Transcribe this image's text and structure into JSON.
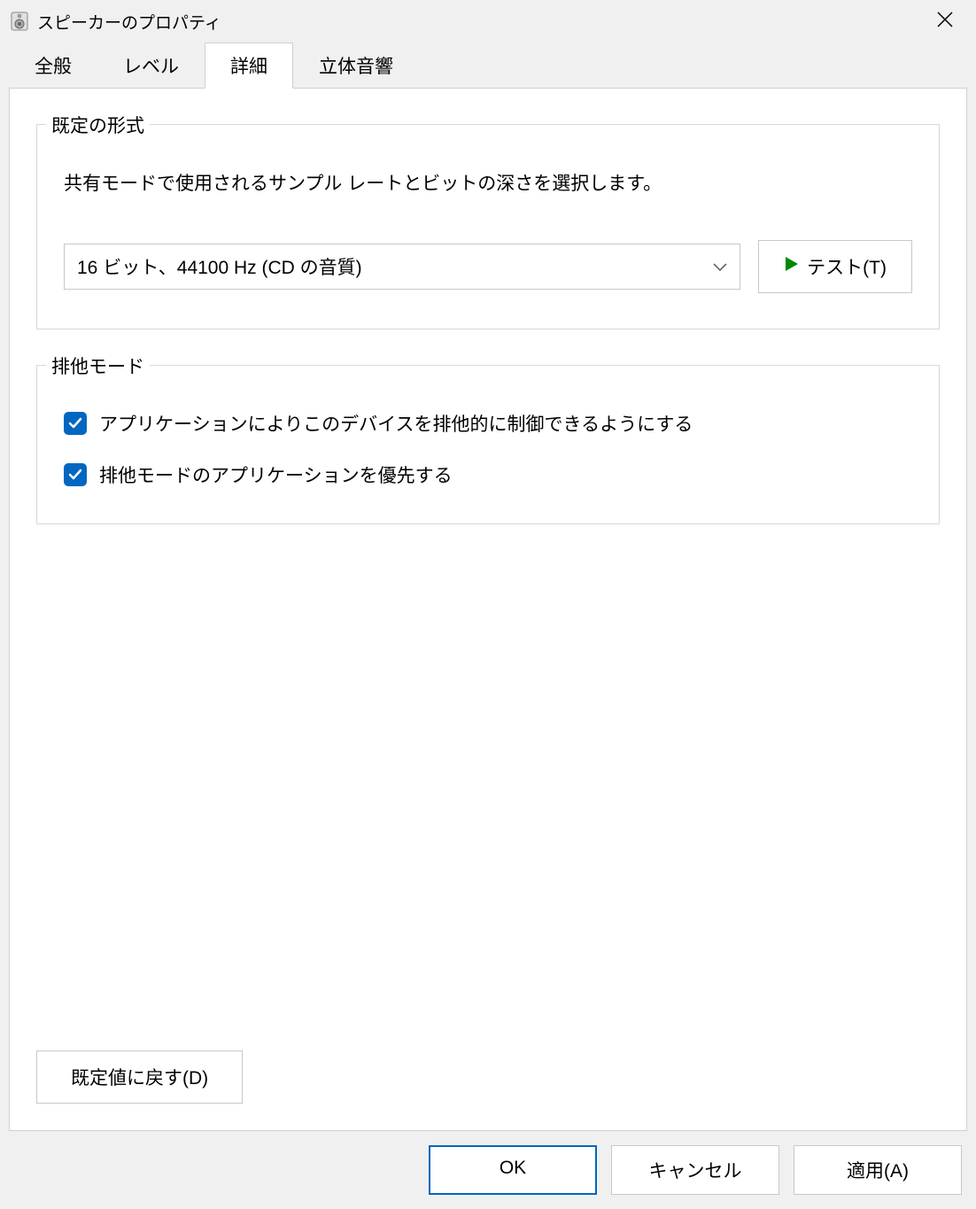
{
  "window": {
    "title": "スピーカーのプロパティ"
  },
  "tabs": {
    "items": [
      {
        "label": "全般"
      },
      {
        "label": "レベル"
      },
      {
        "label": "詳細"
      },
      {
        "label": "立体音響"
      }
    ],
    "active_index": 2
  },
  "default_format": {
    "legend": "既定の形式",
    "description": "共有モードで使用されるサンプル レートとビットの深さを選択します。",
    "selected_value": "16 ビット、44100 Hz (CD の音質)",
    "test_button": "テスト(T)"
  },
  "exclusive_mode": {
    "legend": "排他モード",
    "checkbox1": {
      "label": "アプリケーションによりこのデバイスを排他的に制御できるようにする",
      "checked": true
    },
    "checkbox2": {
      "label": "排他モードのアプリケーションを優先する",
      "checked": true
    }
  },
  "buttons": {
    "restore_defaults": "既定値に戻す(D)",
    "ok": "OK",
    "cancel": "キャンセル",
    "apply": "適用(A)"
  }
}
